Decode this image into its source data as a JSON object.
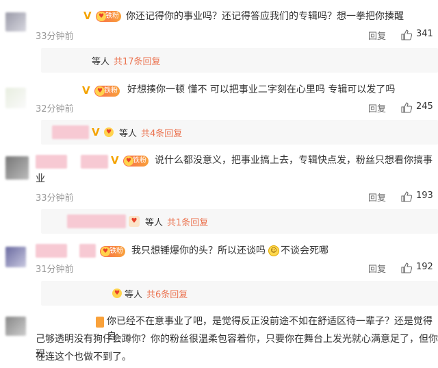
{
  "comments": [
    {
      "text": "你还记得你的事业吗？还记得答应我们的专辑吗？想一拳把你揍醒",
      "time": "33分钟前",
      "reply_label": "回复",
      "likes": "341",
      "thread": {
        "etc": "等人",
        "count": "共17条回复"
      }
    },
    {
      "text": "好想揍你一顿 懂不 可以把事业二字刻在心里吗 专辑可以发了吗",
      "time": "32分钟前",
      "reply_label": "回复",
      "likes": "245",
      "thread": {
        "etc": "等人",
        "count": "共4条回复"
      }
    },
    {
      "text_line1": "说什么都没意义，把事业搞上去，专辑快点发，粉丝只想看你搞事",
      "text_line2": "业",
      "time": "33分钟前",
      "reply_label": "回复",
      "likes": "193",
      "thread": {
        "etc": "等人",
        "count": "共1条回复"
      }
    },
    {
      "text_a": "我只想锤爆你的头？所以还谈吗",
      "text_b": "不谈会死哪",
      "time": "31分钟前",
      "reply_label": "回复",
      "likes": "192",
      "thread": {
        "etc": "等人",
        "count": "共6条回复"
      }
    },
    {
      "line1": "你已经不在意事业了吧，是觉得反正没前途不如在舒适区待一辈子？还是觉得自",
      "line2": "己够透明没有狗仔会蹲你？你的粉丝很温柔包容着你，只要你在舞台上发光就心满意足了，但你现",
      "line3": "在连这个也做不到了。"
    }
  ],
  "badges": {
    "verified": "V",
    "fan_label": "铁粉",
    "fan_heart": "♥"
  },
  "icons": {
    "like": "thumbs-up-icon",
    "emoji": "emoji-face-icon"
  },
  "colors": {
    "accent": "#eb7350",
    "muted": "#999999",
    "bar": "#f7f7f7"
  }
}
